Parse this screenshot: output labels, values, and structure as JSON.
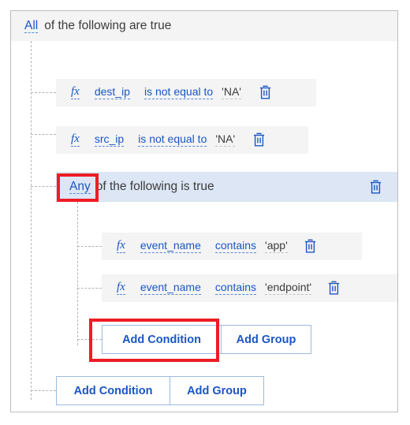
{
  "builder": {
    "root_group": {
      "operator_label": "All",
      "description": "of the following are true",
      "conditions": [
        {
          "fx_label": "fx",
          "field": "dest_ip",
          "operator": "is not equal to",
          "value": "'NA'",
          "delete_icon": "trash-icon"
        },
        {
          "fx_label": "fx",
          "field": "src_ip",
          "operator": "is not equal to",
          "value": "'NA'",
          "delete_icon": "trash-icon"
        }
      ],
      "nested_group": {
        "operator_label": "Any",
        "description": "of the following is true",
        "delete_icon": "trash-icon",
        "conditions": [
          {
            "fx_label": "fx",
            "field": "event_name",
            "operator": "contains",
            "value": "'app'",
            "delete_icon": "trash-icon"
          },
          {
            "fx_label": "fx",
            "field": "event_name",
            "operator": "contains",
            "value": "'endpoint'",
            "delete_icon": "trash-icon"
          }
        ],
        "actions": {
          "add_condition_label": "Add Condition",
          "add_group_label": "Add Group"
        }
      },
      "actions": {
        "add_condition_label": "Add Condition",
        "add_group_label": "Add Group"
      }
    }
  },
  "annotations": {
    "highlight_color": "#ee1c25",
    "highlighted_elements": [
      "Any",
      "Add Condition"
    ]
  },
  "theme": {
    "link_color": "#1a56c4",
    "row_background": "#f4f4f4",
    "group_background": "#dce6f4",
    "border_color": "#9db9e0"
  }
}
